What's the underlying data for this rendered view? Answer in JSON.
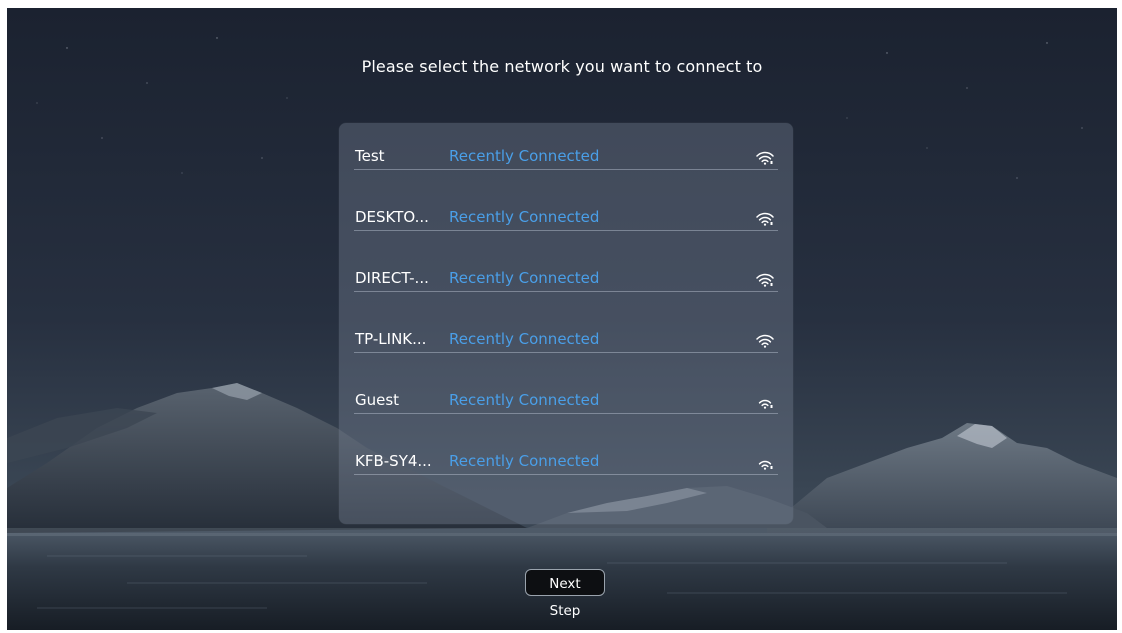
{
  "title": "Please select the network you want to connect to",
  "accent_color": "#4a9fe8",
  "networks": [
    {
      "ssid": "Test",
      "status": "Recently Connected",
      "icon": "wifi-signal-icon"
    },
    {
      "ssid": "DESKTO...",
      "status": "Recently Connected",
      "icon": "wifi-signal-icon"
    },
    {
      "ssid": "DIRECT-...",
      "status": "Recently Connected",
      "icon": "wifi-signal-icon"
    },
    {
      "ssid": "TP-LINK...",
      "status": "Recently Connected",
      "icon": "wifi-signal-icon"
    },
    {
      "ssid": "Guest",
      "status": "Recently Connected",
      "icon": "wifi-signal-icon"
    },
    {
      "ssid": "KFB-SY4...",
      "status": "Recently Connected",
      "icon": "wifi-signal-icon"
    }
  ],
  "next_button_label": "Next Step"
}
